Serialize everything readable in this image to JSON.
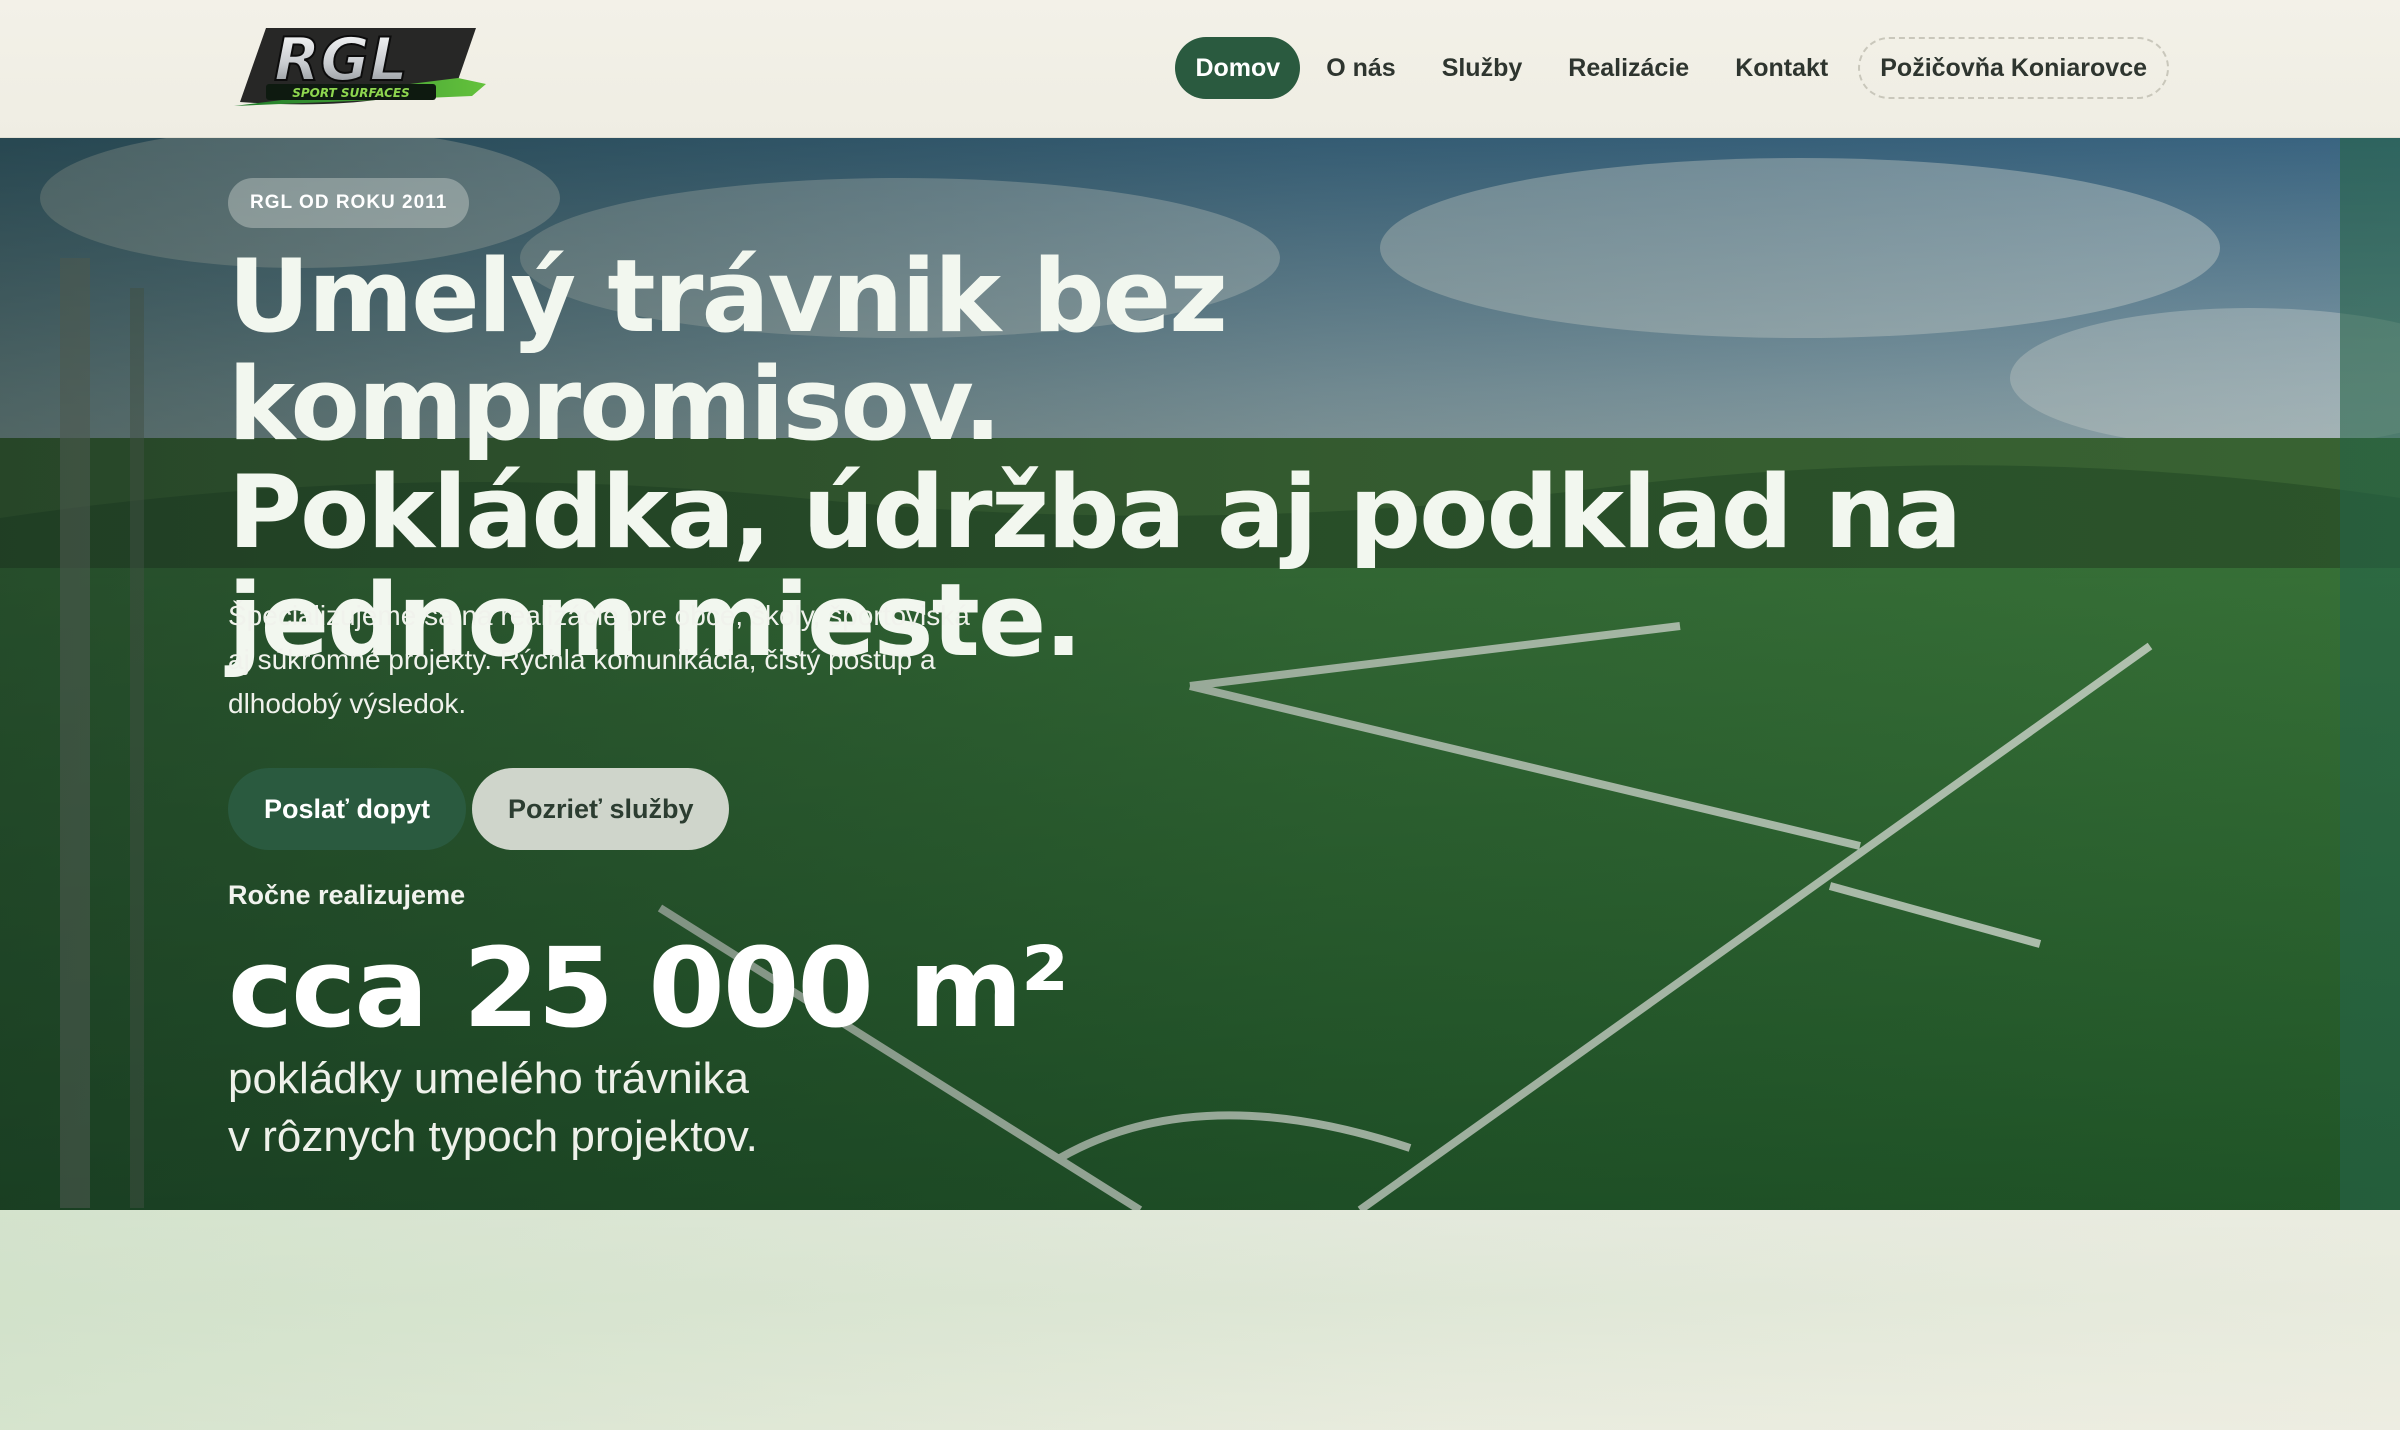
{
  "brand": {
    "logo_text": "RGL",
    "logo_tagline": "SPORT SURFACES"
  },
  "nav": {
    "items": [
      {
        "label": "Domov",
        "active": true
      },
      {
        "label": "O nás"
      },
      {
        "label": "Služby"
      },
      {
        "label": "Realizácie"
      },
      {
        "label": "Kontakt"
      },
      {
        "label": "Požičovňa Koniarovce",
        "outlined": true
      }
    ]
  },
  "hero": {
    "badge": "RGL OD ROKU 2011",
    "headline_lines": [
      "Umelý trávnik bez kompromisov.",
      "Pokládka, údržba aj podklad na",
      "jednom mieste."
    ],
    "lead": "Špecializujeme sa na realizácie pre obce, školy, športoviská aj súkromné projekty. Rýchla komunikácia, čistý postup a dlhodobý výsledok.",
    "buttons": {
      "primary": "Poslať dopyt",
      "secondary": "Pozrieť služby"
    },
    "stat": {
      "label": "Ročne realizujeme",
      "value": "cca 25 000 m²",
      "desc_lines": [
        "pokládky umelého trávnika",
        "v rôznych typoch projektov."
      ]
    }
  },
  "colors": {
    "accent": "#2a5a3f",
    "page_bg": "#f1efe6",
    "turf": "#2e6b33"
  }
}
